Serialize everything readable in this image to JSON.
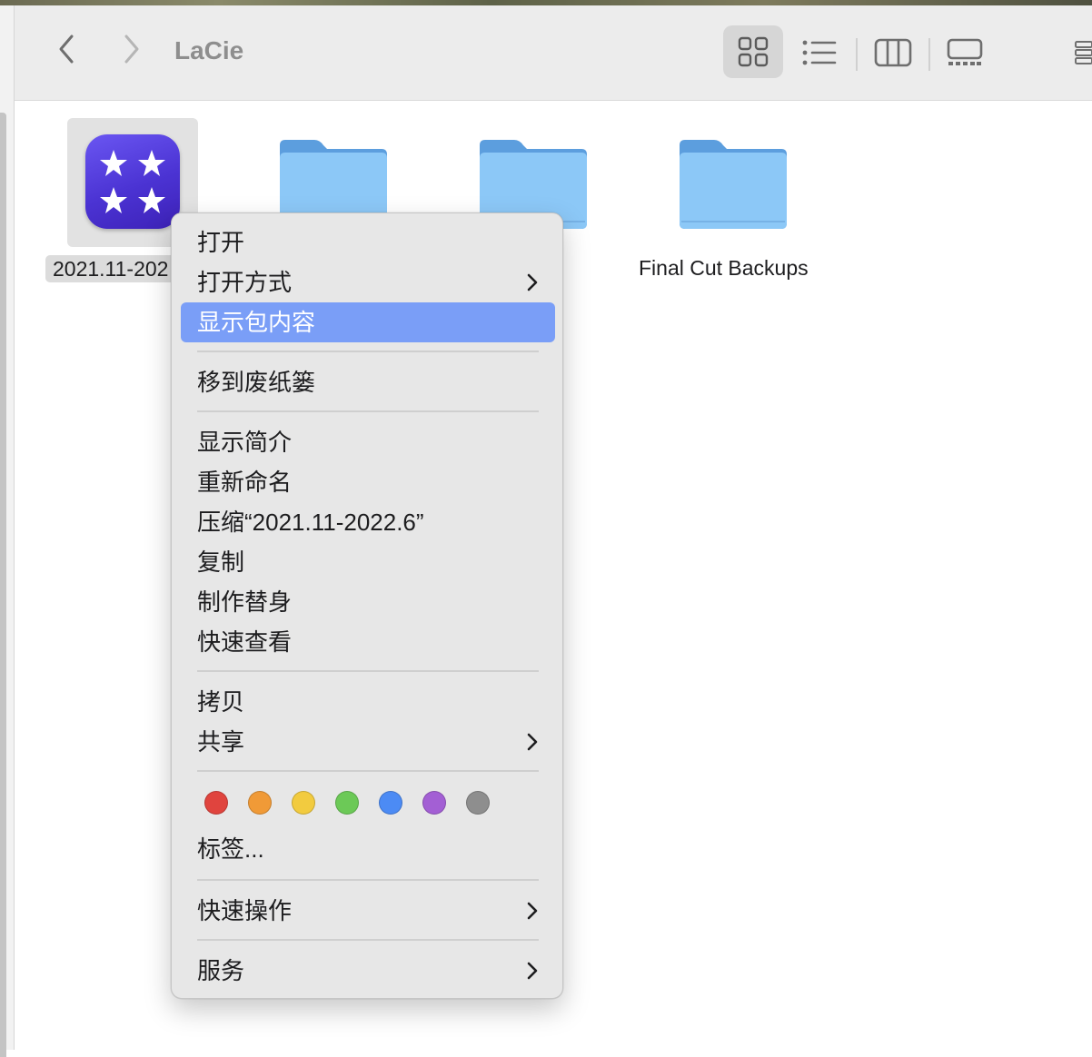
{
  "window": {
    "title": "LaCie"
  },
  "toolbar": {
    "back_icon": "chevron-left-icon",
    "forward_icon": "chevron-right-icon",
    "views": [
      "icon-view-icon",
      "list-view-icon",
      "column-view-icon",
      "gallery-view-icon"
    ]
  },
  "files": [
    {
      "label": "2021.11-202",
      "kind": "app",
      "selected": true
    },
    {
      "label": "",
      "kind": "folder"
    },
    {
      "label": "",
      "kind": "folder"
    },
    {
      "label": "Final Cut Backups",
      "kind": "folder"
    }
  ],
  "context_menu": {
    "items": [
      {
        "label": "打开",
        "submenu": false
      },
      {
        "label": "打开方式",
        "submenu": true
      },
      {
        "label": "显示包内容",
        "submenu": false,
        "highlighted": true
      },
      {
        "label": "移到废纸篓",
        "submenu": false
      },
      {
        "label": "显示简介",
        "submenu": false
      },
      {
        "label": "重新命名",
        "submenu": false
      },
      {
        "label": "压缩“2021.11-2022.6”",
        "submenu": false
      },
      {
        "label": "复制",
        "submenu": false
      },
      {
        "label": "制作替身",
        "submenu": false
      },
      {
        "label": "快速查看",
        "submenu": false
      },
      {
        "label": "拷贝",
        "submenu": false
      },
      {
        "label": "共享",
        "submenu": true
      },
      {
        "label": "标签...",
        "submenu": false
      },
      {
        "label": "快速操作",
        "submenu": true
      },
      {
        "label": "服务",
        "submenu": true
      }
    ],
    "tag_colors": [
      "#e0443e",
      "#f09a37",
      "#f2cb3f",
      "#6cc957",
      "#4c8bf4",
      "#a35fd4",
      "#8e8e8e"
    ]
  },
  "colors": {
    "highlight": "#7a9ef7",
    "folder": "#7fbdf2",
    "app_icon": "#5b44e6"
  }
}
